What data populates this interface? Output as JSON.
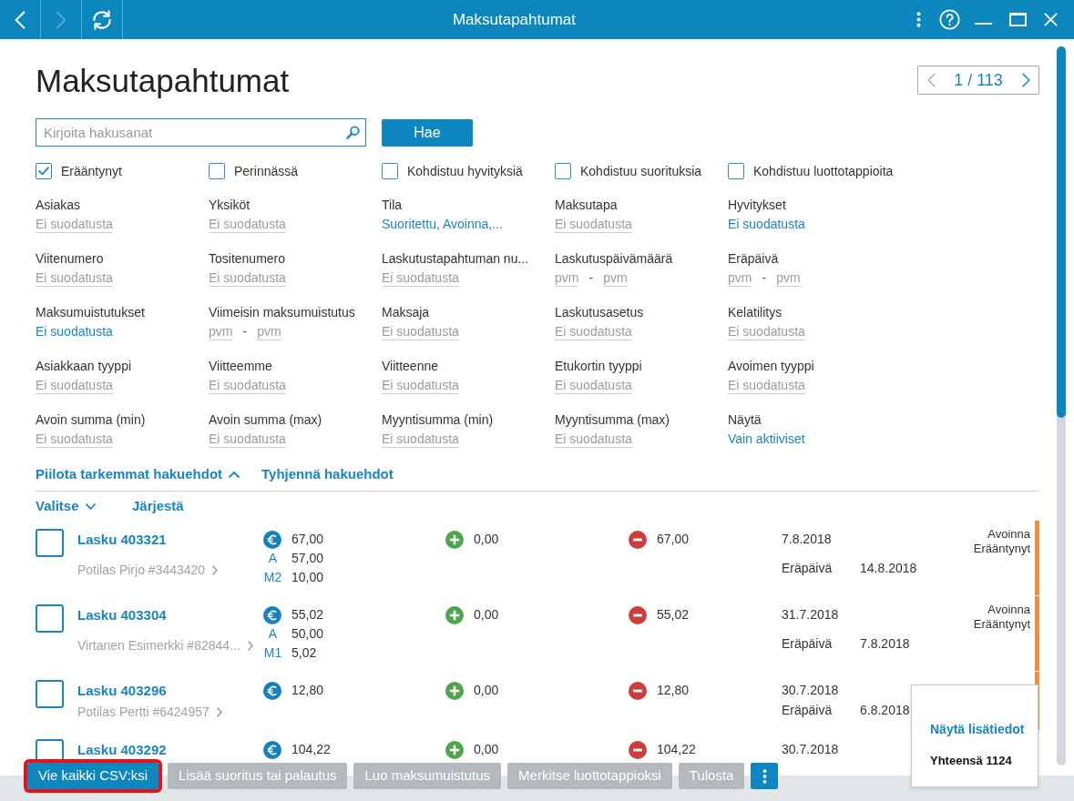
{
  "window": {
    "title": "Maksutapahtumat"
  },
  "nav_buttons": [
    {
      "kind": "back",
      "disabled": false
    },
    {
      "kind": "forward",
      "disabled": true
    },
    {
      "kind": "refresh",
      "disabled": false
    }
  ],
  "page": {
    "heading": "Maksutapahtumat",
    "pager": {
      "label": "1 / 113",
      "previous_disabled": true,
      "next_disabled": false
    }
  },
  "search": {
    "placeholder": "Kirjoita hakusanat",
    "button": "Hae"
  },
  "checkboxes": [
    {
      "label": "Erääntynyt",
      "checked": true
    },
    {
      "label": "Perinnässä",
      "checked": false
    },
    {
      "label": "Kohdistuu hyvityksiä",
      "checked": false
    },
    {
      "label": "Kohdistuu suorituksia",
      "checked": false
    },
    {
      "label": "Kohdistuu luottotappioita",
      "checked": false
    }
  ],
  "filters": [
    {
      "label": "Asiakas",
      "kind": "text",
      "value": "Ei suodatusta",
      "active": false
    },
    {
      "label": "Yksiköt",
      "kind": "text",
      "value": "Ei suodatusta",
      "active": false
    },
    {
      "label": "Tila",
      "kind": "text",
      "value": "Suoritettu, Avoinna,...",
      "active": true
    },
    {
      "label": "Maksutapa",
      "kind": "text",
      "value": "Ei suodatusta",
      "active": false
    },
    {
      "label": "Hyvitykset",
      "kind": "text",
      "value": "Ei suodatusta",
      "active": true
    },
    {
      "label": "Viitenumero",
      "kind": "text",
      "value": "Ei suodatusta",
      "active": false
    },
    {
      "label": "Tositenumero",
      "kind": "text",
      "value": "Ei suodatusta",
      "active": false
    },
    {
      "label": "Laskutustapahtuman nu...",
      "kind": "text",
      "value": "Ei suodatusta",
      "active": false
    },
    {
      "label": "Laskutuspäivämäärä",
      "kind": "range",
      "from": "pvm",
      "separator": "-",
      "to": "pvm",
      "active": false
    },
    {
      "label": "Eräpäivä",
      "kind": "range",
      "from": "pvm",
      "separator": "-",
      "to": "pvm",
      "active": false
    },
    {
      "label": "Maksumuistutukset",
      "kind": "text",
      "value": "Ei suodatusta",
      "active": true
    },
    {
      "label": "Viimeisin maksumuistutus",
      "kind": "range",
      "from": "pvm",
      "separator": "-",
      "to": "pvm",
      "active": false
    },
    {
      "label": "Maksaja",
      "kind": "text",
      "value": "Ei suodatusta",
      "active": false
    },
    {
      "label": "Laskutusasetus",
      "kind": "text",
      "value": "Ei suodatusta",
      "active": false
    },
    {
      "label": "Kelatilitys",
      "kind": "text",
      "value": "Ei suodatusta",
      "active": false
    },
    {
      "label": "Asiakkaan tyyppi",
      "kind": "text",
      "value": "Ei suodatusta",
      "active": false
    },
    {
      "label": "Viitteemme",
      "kind": "text",
      "value": "Ei suodatusta",
      "active": false
    },
    {
      "label": "Viitteenne",
      "kind": "text",
      "value": "Ei suodatusta",
      "active": false
    },
    {
      "label": "Etukortin tyyppi",
      "kind": "text",
      "value": "Ei suodatusta",
      "active": false
    },
    {
      "label": "Avoimen tyyppi",
      "kind": "text",
      "value": "Ei suodatusta",
      "active": false
    },
    {
      "label": "Avoin summa (min)",
      "kind": "text",
      "value": "Ei suodatusta",
      "active": false
    },
    {
      "label": "Avoin summa (max)",
      "kind": "text",
      "value": "Ei suodatusta",
      "active": false
    },
    {
      "label": "Myyntisumma (min)",
      "kind": "text",
      "value": "Ei suodatusta",
      "active": false
    },
    {
      "label": "Myyntisumma (max)",
      "kind": "text",
      "value": "Ei suodatusta",
      "active": false
    },
    {
      "label": "Näytä",
      "kind": "text",
      "value": "Vain aktiiviset",
      "active": true
    }
  ],
  "filter_toggle": {
    "label": "Piilota tarkemmat hakuehdot",
    "expanded": true
  },
  "clear_link": "Tyhjennä hakuehdot",
  "list_actions": [
    {
      "label": "Valitse",
      "kind": "dropdown"
    },
    {
      "label": "Järjestä",
      "kind": "link"
    }
  ],
  "rows": [
    {
      "title": "Lasku 403321",
      "customer": "Potilas Pirjo #3443420",
      "selected": false,
      "amount": "67,00",
      "amount_parts": [
        {
          "label": "A",
          "value": "57,00"
        },
        {
          "label": "M2",
          "value": "10,00"
        }
      ],
      "credits": "0,00",
      "open": "67,00",
      "date": "7.8.2018",
      "due_label": "Eräpäivä",
      "due_date": "14.8.2018",
      "status": [
        "Avoinna",
        "Erääntynyt"
      ],
      "color": "#e9913a"
    },
    {
      "title": "Lasku 403304",
      "customer": "Virtanen Esimerkki #82844...",
      "selected": false,
      "amount": "55,02",
      "amount_parts": [
        {
          "label": "A",
          "value": "50,00"
        },
        {
          "label": "M1",
          "value": "5,02"
        }
      ],
      "credits": "0,00",
      "open": "55,02",
      "date": "31.7.2018",
      "due_label": "Eräpäivä",
      "due_date": "7.8.2018",
      "status": [
        "Avoinna",
        "Erääntynyt"
      ],
      "color": "#e9913a"
    },
    {
      "title": "Lasku 403296",
      "customer": "Potilas Pertti #6424957",
      "selected": false,
      "amount": "12,80",
      "credits": "0,00",
      "open": "12,80",
      "date": "30.7.2018",
      "due_label": "Eräpäivä",
      "due_date": "6.8.2018",
      "color": "#e9913a"
    },
    {
      "title": "Lasku 403292",
      "selected": false,
      "amount": "104,22",
      "credits": "0,00",
      "open": "104,22",
      "date": "30.7.2018"
    }
  ],
  "footer_buttons": [
    {
      "kind": "text",
      "label": "Vie kaikki CSV:ksi",
      "disabled": false,
      "highlighted": true
    },
    {
      "kind": "text",
      "label": "Lisää suoritus tai palautus",
      "disabled": true,
      "highlighted": false
    },
    {
      "kind": "text",
      "label": "Luo maksumuistutus",
      "disabled": true,
      "highlighted": false
    },
    {
      "kind": "text",
      "label": "Merkitse luottotappioksi",
      "disabled": true,
      "highlighted": false
    },
    {
      "kind": "text",
      "label": "Tulosta",
      "disabled": true,
      "highlighted": false
    },
    {
      "kind": "more",
      "disabled": false,
      "highlighted": false
    }
  ],
  "popover": {
    "link": "Näytä lisätiedot",
    "total": "Yhteensä 1124"
  }
}
